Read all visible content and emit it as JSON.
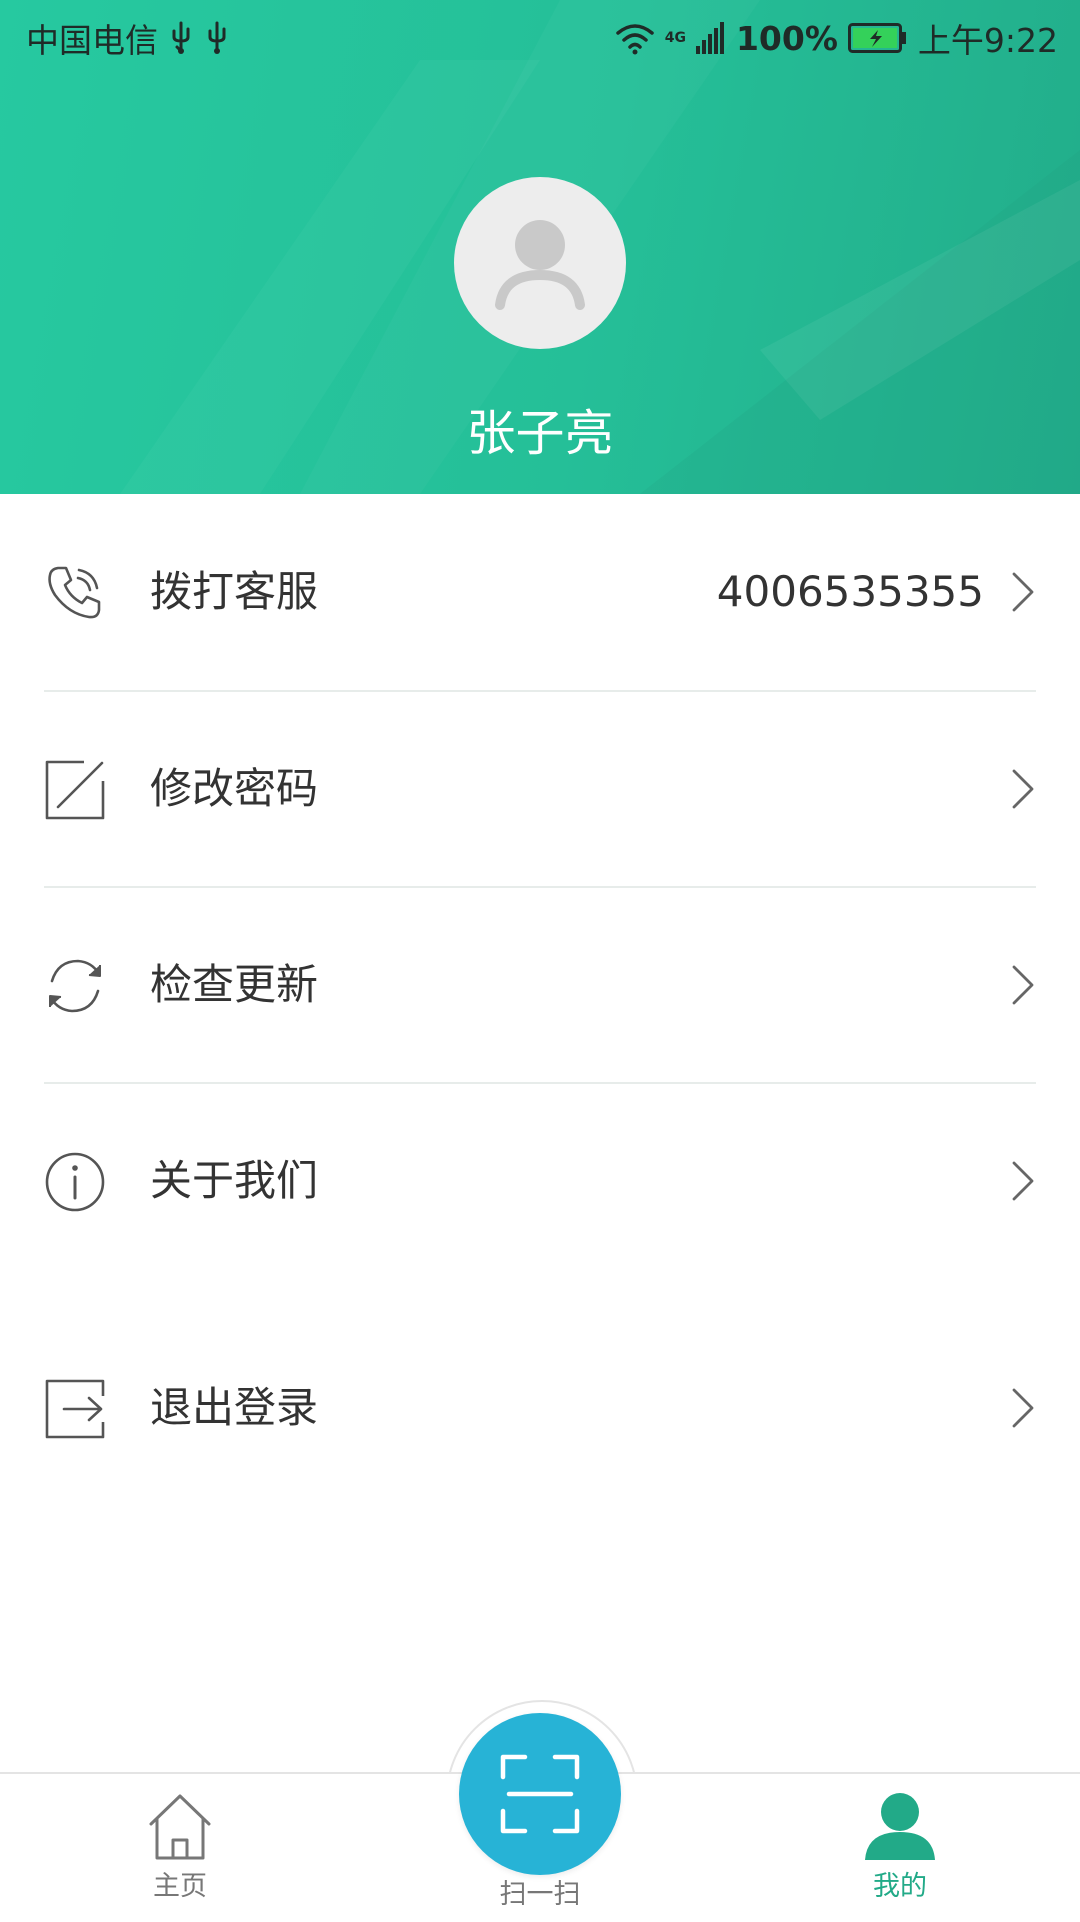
{
  "colors": {
    "header_bg": "#26c9a0",
    "accent": "#22aa88",
    "scan_button": "#27b3d6",
    "text": "#333333",
    "nav_inactive": "#777777"
  },
  "status_bar": {
    "carrier": "中国电信",
    "network": "4G",
    "battery": "100%",
    "time": "上午9:22"
  },
  "profile": {
    "name": "张子亮"
  },
  "menu": [
    {
      "label": "拨打客服",
      "value": "4006535355",
      "icon": "phone-icon"
    },
    {
      "label": "修改密码",
      "value": "",
      "icon": "edit-icon"
    },
    {
      "label": "检查更新",
      "value": "",
      "icon": "refresh-icon"
    },
    {
      "label": "关于我们",
      "value": "",
      "icon": "info-icon"
    },
    {
      "label": "退出登录",
      "value": "",
      "icon": "logout-icon"
    }
  ],
  "bottom_nav": {
    "home": {
      "label": "主页",
      "icon": "home-icon"
    },
    "scan": {
      "label": "扫一扫",
      "icon": "scan-icon"
    },
    "me": {
      "label": "我的",
      "icon": "user-icon",
      "active": true
    }
  }
}
